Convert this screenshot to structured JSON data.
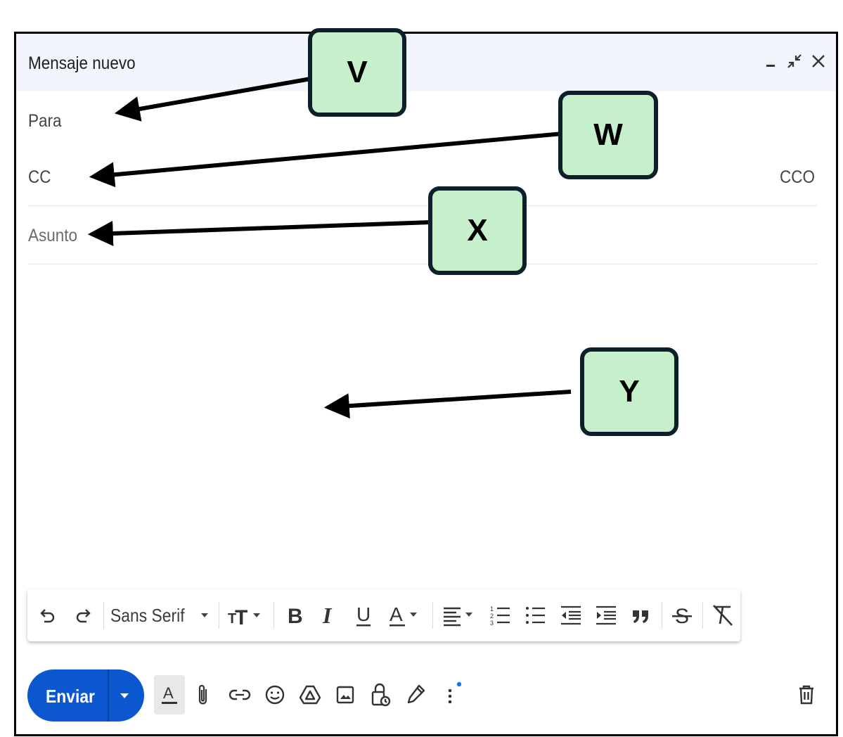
{
  "compose": {
    "title": "Mensaje nuevo",
    "to_label": "Para",
    "cc_label": "CC",
    "bcc_label": "CCO",
    "subject_placeholder": "Asunto"
  },
  "toolbar": {
    "font_name": "Sans Serif"
  },
  "actions": {
    "send_label": "Enviar"
  },
  "callouts": {
    "v": "V",
    "w": "W",
    "x": "X",
    "y": "Y"
  },
  "colors": {
    "send_button": "#0b57d0",
    "callout_fill": "#c6efcb",
    "header_bg": "#f2f6fc",
    "notification_dot": "#1a73e8"
  }
}
